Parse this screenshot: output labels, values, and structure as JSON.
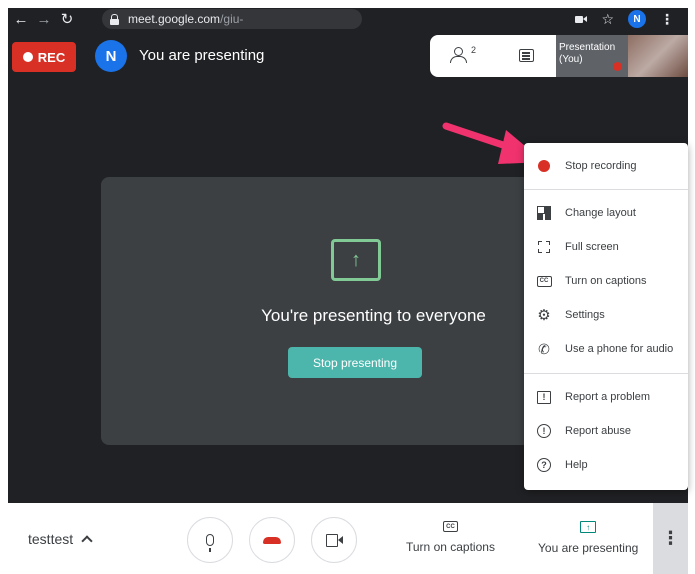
{
  "browser": {
    "url_host": "meet.google.com",
    "url_path": "/giu- ",
    "profile_initial": "N",
    "icons": [
      "back-icon",
      "forward-icon",
      "reload-icon",
      "lock-icon",
      "camera-icon",
      "star-icon",
      "kebab-icon"
    ]
  },
  "header": {
    "rec_label": "REC",
    "presenter_initial": "N",
    "presenting_text": "You are presenting"
  },
  "top_panel": {
    "people_count": "2",
    "self_tile_label_line1": "Presentation",
    "self_tile_label_line2": "(You)"
  },
  "share_card": {
    "heading": "You're presenting to everyone",
    "stop_button": "Stop presenting"
  },
  "menu": {
    "items": [
      {
        "label": "Stop recording",
        "icon": "record-dot-icon"
      },
      {
        "label": "Change layout",
        "icon": "layout-icon"
      },
      {
        "label": "Full screen",
        "icon": "fullscreen-icon"
      },
      {
        "label": "Turn on captions",
        "icon": "captions-icon"
      },
      {
        "label": "Settings",
        "icon": "gear-icon"
      },
      {
        "label": "Use a phone for audio",
        "icon": "phone-icon"
      },
      {
        "label": "Report a problem",
        "icon": "report-icon"
      },
      {
        "label": "Report abuse",
        "icon": "alert-icon"
      },
      {
        "label": "Help",
        "icon": "help-icon"
      }
    ]
  },
  "bottom_bar": {
    "meeting_name": "testtest",
    "captions_label": "Turn on captions",
    "presenting_label": "You are presenting"
  },
  "colors": {
    "stage_bg": "#202124",
    "rec_red": "#d93025",
    "teal": "#4db6ac",
    "annotation_pink": "#f0326e"
  }
}
